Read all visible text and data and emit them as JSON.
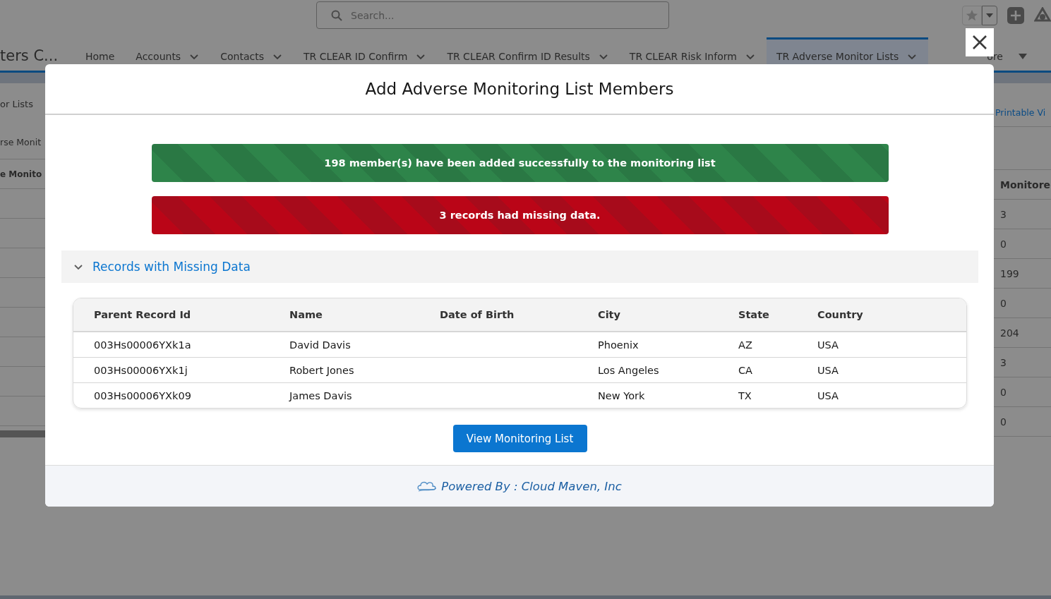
{
  "top_bar": {
    "search": {
      "placeholder": "Search..."
    }
  },
  "app_name": "ters C...",
  "nav_tabs": [
    {
      "label": "Home",
      "kind": "tab",
      "has_menu": false,
      "selected": false
    },
    {
      "label": "Accounts",
      "kind": "tab",
      "has_menu": true,
      "selected": false
    },
    {
      "label": "Contacts",
      "kind": "tab",
      "has_menu": true,
      "selected": false
    },
    {
      "label": "TR CLEAR ID Confirm",
      "kind": "tab",
      "has_menu": true,
      "selected": false
    },
    {
      "label": "TR CLEAR Confirm ID Results",
      "kind": "tab",
      "has_menu": true,
      "selected": false
    },
    {
      "label": "TR CLEAR Risk Inform",
      "kind": "tab",
      "has_menu": true,
      "selected": false
    },
    {
      "label": "TR Adverse Monitor Lists",
      "kind": "tab",
      "has_menu": true,
      "selected": true
    },
    {
      "label": "ore",
      "kind": "more",
      "has_menu": true,
      "selected": false
    }
  ],
  "background_page": {
    "left_column": {
      "title": "or Lists",
      "subtitle": "rse Monit",
      "column_header": "e Monito"
    },
    "right_column": {
      "link": "Printable Vi",
      "column_header": "Monitore",
      "values": [
        "3",
        "0",
        "199",
        "0",
        "204",
        "3",
        "0",
        "0"
      ]
    }
  },
  "modal": {
    "title": "Add Adverse Monitoring List Members",
    "alerts": [
      {
        "kind": "success",
        "text": "198 member(s) have been added successfully to the monitoring list"
      },
      {
        "kind": "error",
        "text": "3 records had missing data."
      }
    ],
    "section": {
      "title": "Records with Missing Data",
      "expanded": true
    },
    "table": {
      "columns": [
        "Parent Record Id",
        "Name",
        "Date of Birth",
        "City",
        "State",
        "Country"
      ],
      "rows": [
        [
          "003Hs00006YXk1a",
          "David Davis",
          "",
          "Phoenix",
          "AZ",
          "USA"
        ],
        [
          "003Hs00006YXk1j",
          "Robert Jones",
          "",
          "Los Angeles",
          "CA",
          "USA"
        ],
        [
          "003Hs00006YXk09",
          "James Davis",
          "",
          "New York",
          "TX",
          "USA"
        ]
      ]
    },
    "button": "View Monitoring List",
    "footer": "Powered By : Cloud Maven, Inc"
  }
}
